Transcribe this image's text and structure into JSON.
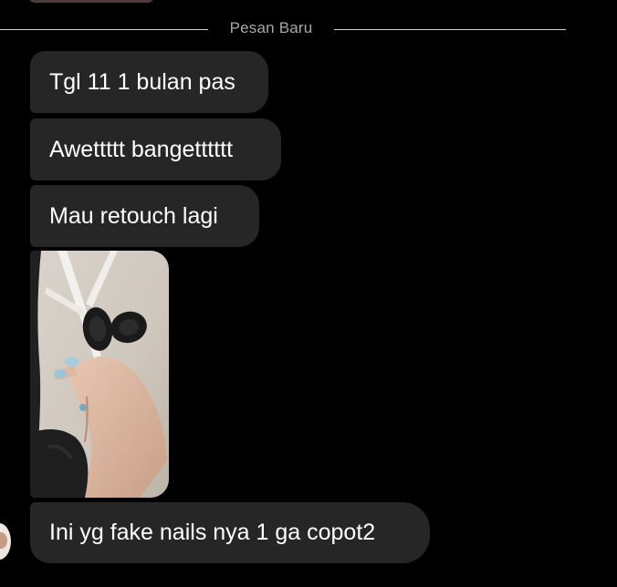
{
  "chat": {
    "divider_label": "Pesan Baru",
    "messages": [
      {
        "text": "Tgl 11 1 bulan pas"
      },
      {
        "text": "Awettttt bangetttttt"
      },
      {
        "text": "Mau retouch lagi"
      },
      {
        "text": "Ini yg fake nails nya 1 ga copot2"
      }
    ]
  },
  "colors": {
    "background": "#000000",
    "bubble": "#262626",
    "text": "#ffffff",
    "divider_text": "#a8a8a8"
  }
}
